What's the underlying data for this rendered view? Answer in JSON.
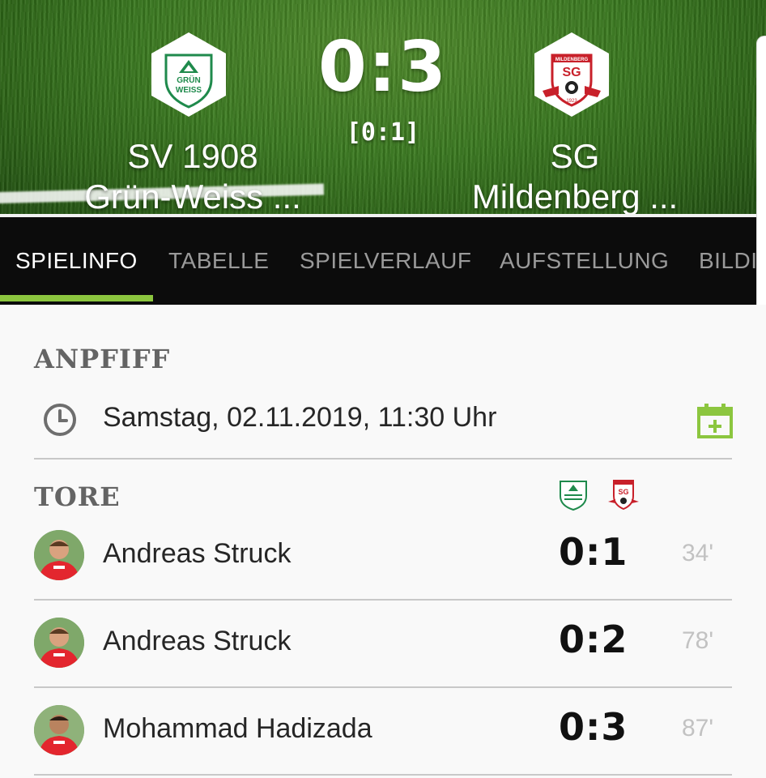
{
  "match": {
    "score": "0:3",
    "halftime": "[0:1]",
    "home": {
      "name": "SV 1908\nGrün-Weiss ...",
      "crest_text_1": "GRÜN",
      "crest_text_2": "WEISS",
      "color": "#1f8a4c"
    },
    "away": {
      "name": "SG\nMildenberg ...",
      "crest_text": "SG",
      "crest_banner": "MILDENBERG",
      "crest_year": "1923",
      "color": "#c8202a"
    }
  },
  "tabs": [
    {
      "label": "SPIELINFO",
      "active": true
    },
    {
      "label": "TABELLE",
      "active": false
    },
    {
      "label": "SPIELVERLAUF",
      "active": false
    },
    {
      "label": "AUFSTELLUNG",
      "active": false
    },
    {
      "label": "BILDI",
      "active": false
    }
  ],
  "kickoff": {
    "title": "ANPFIFF",
    "datetime": "Samstag, 02.11.2019, 11:30 Uhr",
    "icon": "clock-icon",
    "action_icon": "calendar-add-icon"
  },
  "goals": {
    "title": "TORE",
    "items": [
      {
        "player": "Andreas Struck",
        "score": "0:1",
        "minute": "34'"
      },
      {
        "player": "Andreas Struck",
        "score": "0:2",
        "minute": "78'"
      },
      {
        "player": "Mohammad Hadizada",
        "score": "0:3",
        "minute": "87'"
      }
    ]
  },
  "colors": {
    "accent": "#8cc63f",
    "tabbar": "#0c0c0c",
    "away_red": "#c8202a",
    "home_green": "#1f8a4c"
  }
}
